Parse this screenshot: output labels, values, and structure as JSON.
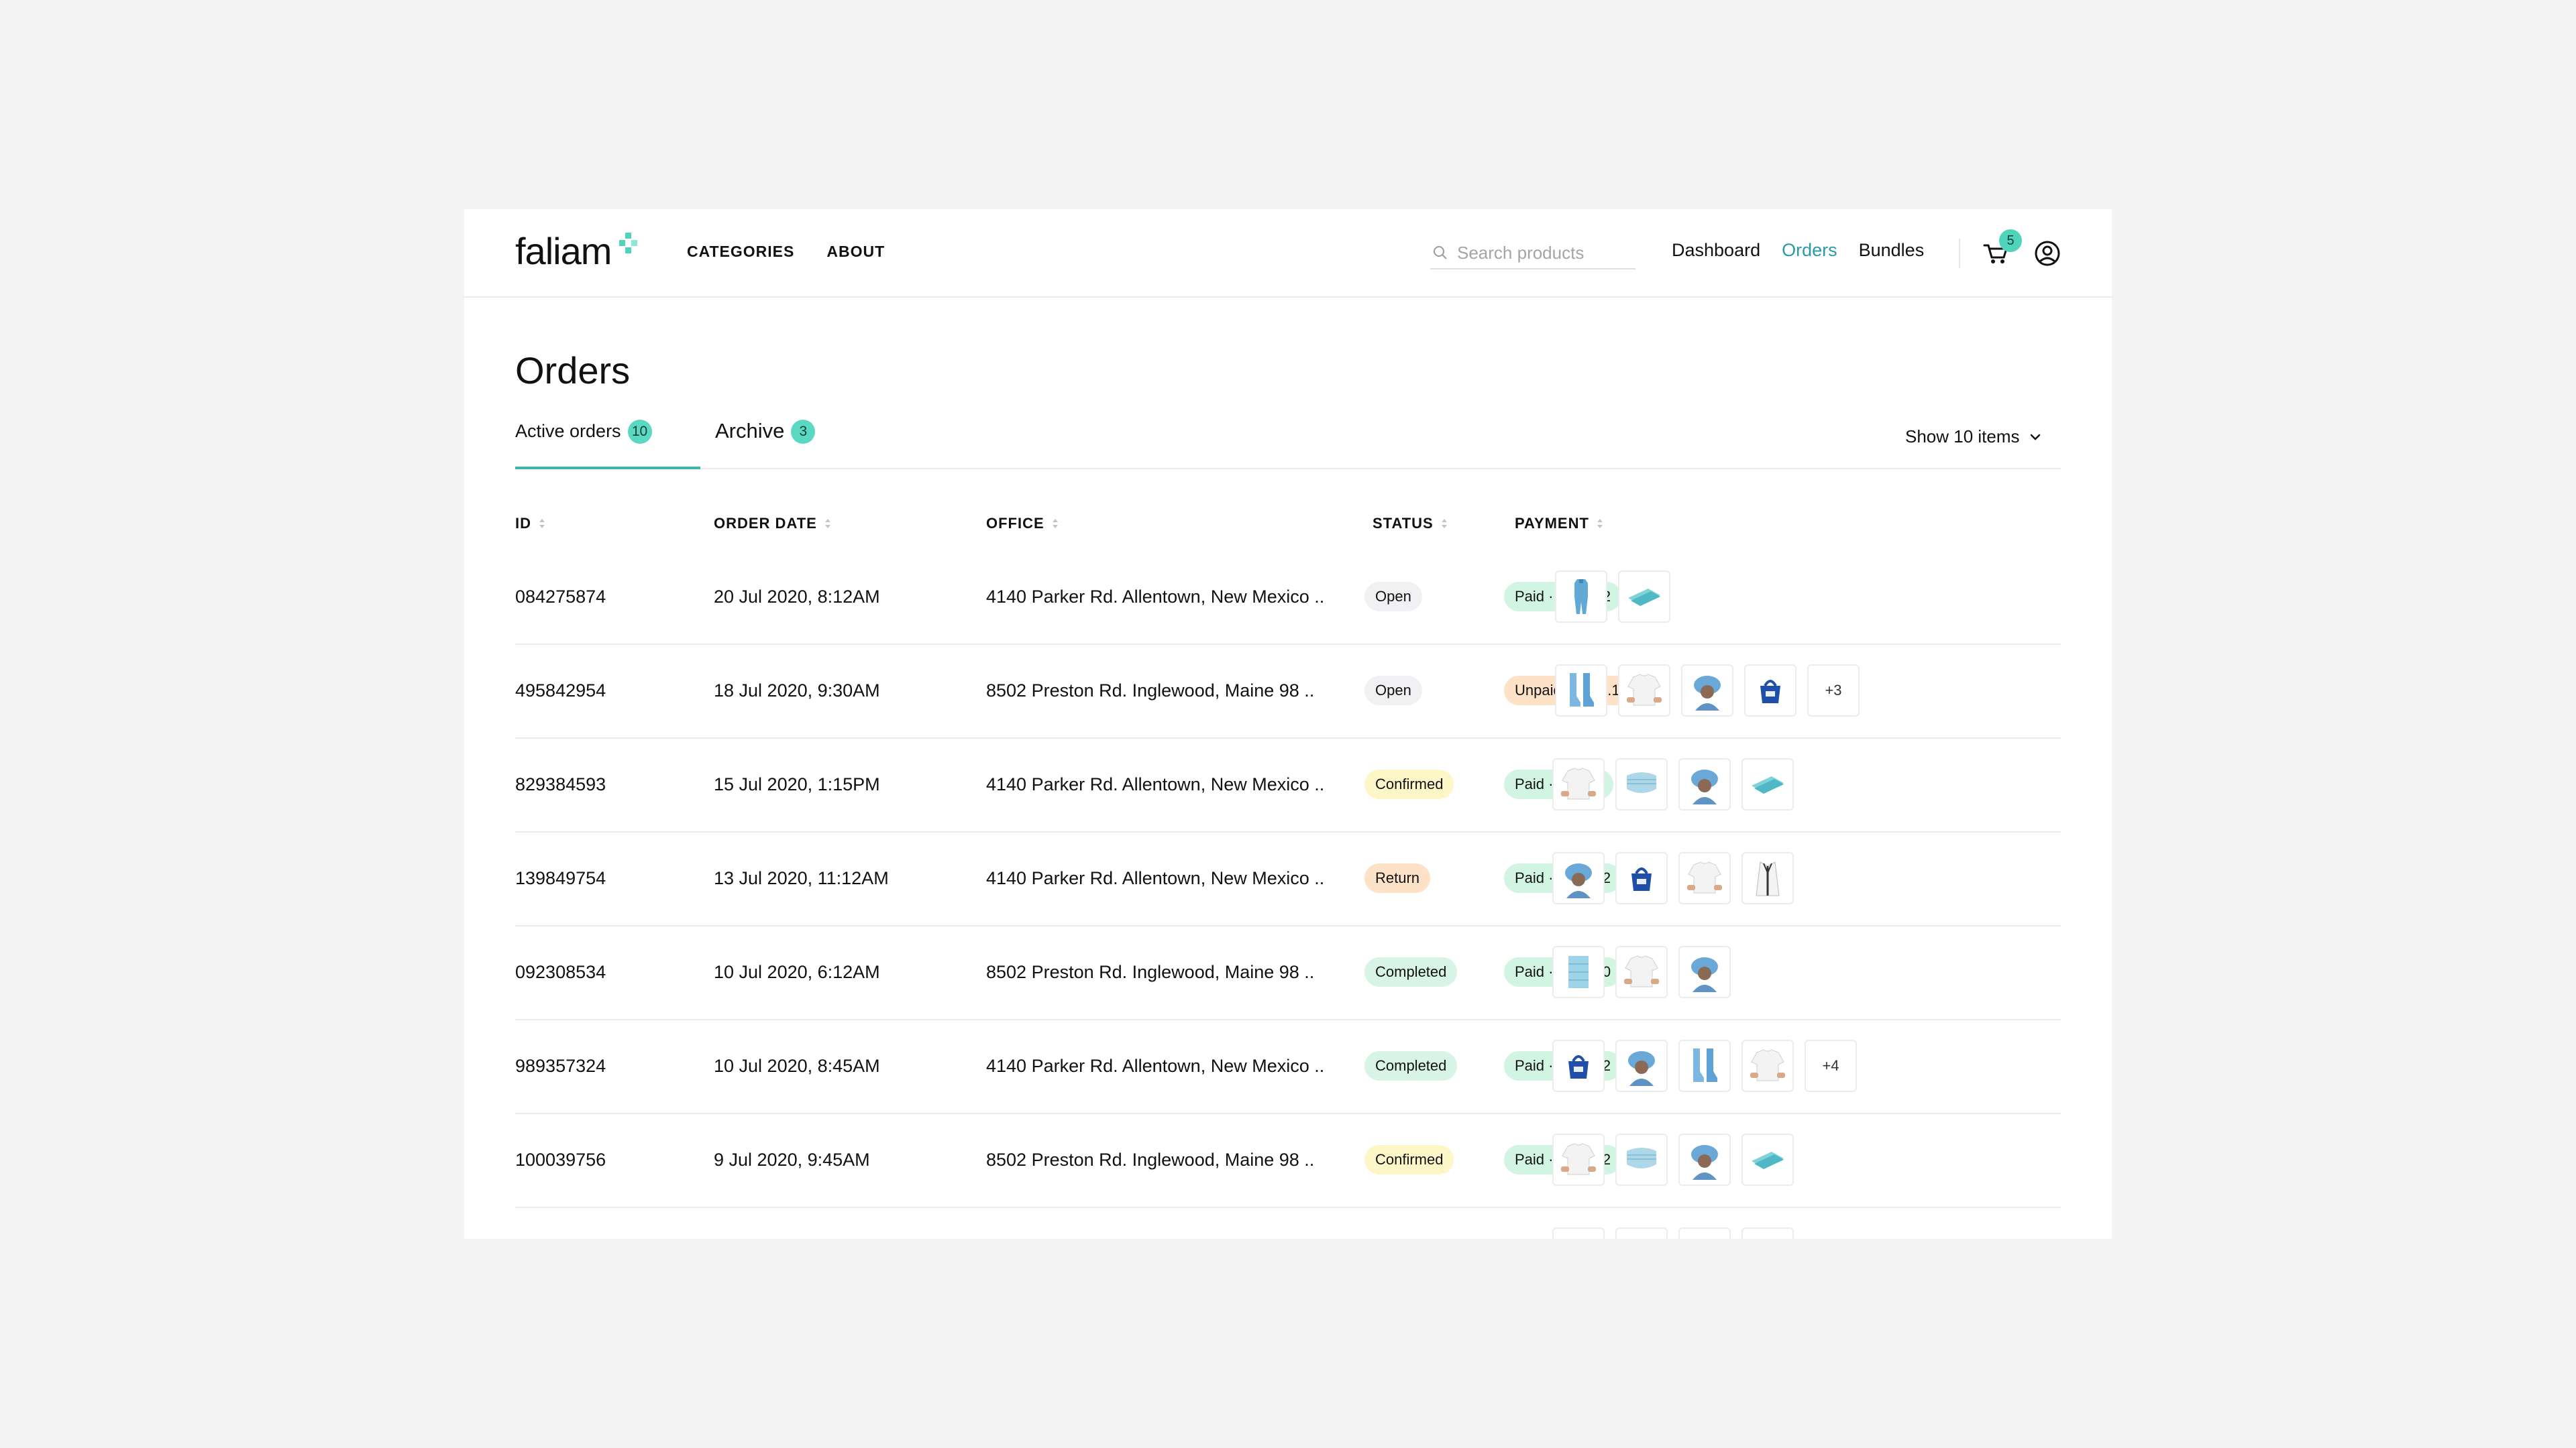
{
  "brand": {
    "name": "faliam"
  },
  "nav": {
    "left": [
      "CATEGORIES",
      "ABOUT"
    ],
    "search_placeholder": "Search products",
    "right": [
      {
        "label": "Dashboard",
        "active": false
      },
      {
        "label": "Orders",
        "active": true
      },
      {
        "label": "Bundles",
        "active": false
      }
    ],
    "cart_count": "5"
  },
  "page": {
    "title": "Orders",
    "tabs": [
      {
        "label": "Active orders",
        "count": "10",
        "active": true
      },
      {
        "label": "Archive",
        "count": "3",
        "active": false
      }
    ],
    "show_items": "Show 10 items"
  },
  "table": {
    "headers": [
      "ID",
      "ORDER DATE",
      "OFFICE",
      "STATUS",
      "PAYMENT"
    ],
    "rows": [
      {
        "id": "084275874",
        "date": "20 Jul 2020, 8:12AM",
        "office": "4140 Parker Rd. Allentown, New Mexico ..",
        "status": "Open",
        "payment": "Paid · $559.22",
        "paid": true,
        "thumbs": [
          "gown",
          "gloves"
        ],
        "more": ""
      },
      {
        "id": "495842954",
        "date": "18 Jul 2020, 9:30AM",
        "office": "8502 Preston Rd. Inglewood, Maine 98 ..",
        "status": "Open",
        "payment": "Unpaid · $284.12",
        "paid": false,
        "thumbs": [
          "shoecover",
          "tshirt",
          "cap",
          "bag"
        ],
        "more": "+3"
      },
      {
        "id": "829384593",
        "date": "15 Jul 2020, 1:15PM",
        "office": "4140 Parker Rd. Allentown, New Mexico ..",
        "status": "Confirmed",
        "payment": "Paid · $85.12",
        "paid": true,
        "thumbs": [
          "tshirt",
          "mask",
          "cap",
          "gloves"
        ],
        "more": ""
      },
      {
        "id": "139849754",
        "date": "13 Jul 2020, 11:12AM",
        "office": "4140 Parker Rd. Allentown, New Mexico ..",
        "status": "Return",
        "payment": "Paid · $456.12",
        "paid": true,
        "thumbs": [
          "cap",
          "bag",
          "tshirt",
          "coat"
        ],
        "more": ""
      },
      {
        "id": "092308534",
        "date": "10 Jul 2020, 6:12AM",
        "office": "8502 Preston Rd. Inglewood, Maine 98 ..",
        "status": "Completed",
        "payment": "Paid · $743.00",
        "paid": true,
        "thumbs": [
          "pad",
          "tshirt",
          "cap"
        ],
        "more": ""
      },
      {
        "id": "989357324",
        "date": "10 Jul 2020, 8:45AM",
        "office": "4140 Parker Rd. Allentown, New Mexico ..",
        "status": "Completed",
        "payment": "Paid · $550.12",
        "paid": true,
        "thumbs": [
          "bag",
          "cap",
          "shoecover",
          "tshirt"
        ],
        "more": "+4"
      },
      {
        "id": "100039756",
        "date": "9 Jul 2020, 9:45AM",
        "office": "8502 Preston Rd. Inglewood, Maine 98 ..",
        "status": "Confirmed",
        "payment": "Paid · $456.12",
        "paid": true,
        "thumbs": [
          "tshirt",
          "mask",
          "cap",
          "gloves"
        ],
        "more": ""
      },
      {
        "id": "",
        "date": "",
        "office": "",
        "status": "",
        "payment": "",
        "paid": true,
        "thumbs": [
          "mask",
          "cap",
          "mask",
          "bag"
        ],
        "more": ""
      }
    ]
  },
  "colors": {
    "accent": "#2a9aa8",
    "badge": "#5ad8c2",
    "product_blue": "#5fa9d4"
  }
}
